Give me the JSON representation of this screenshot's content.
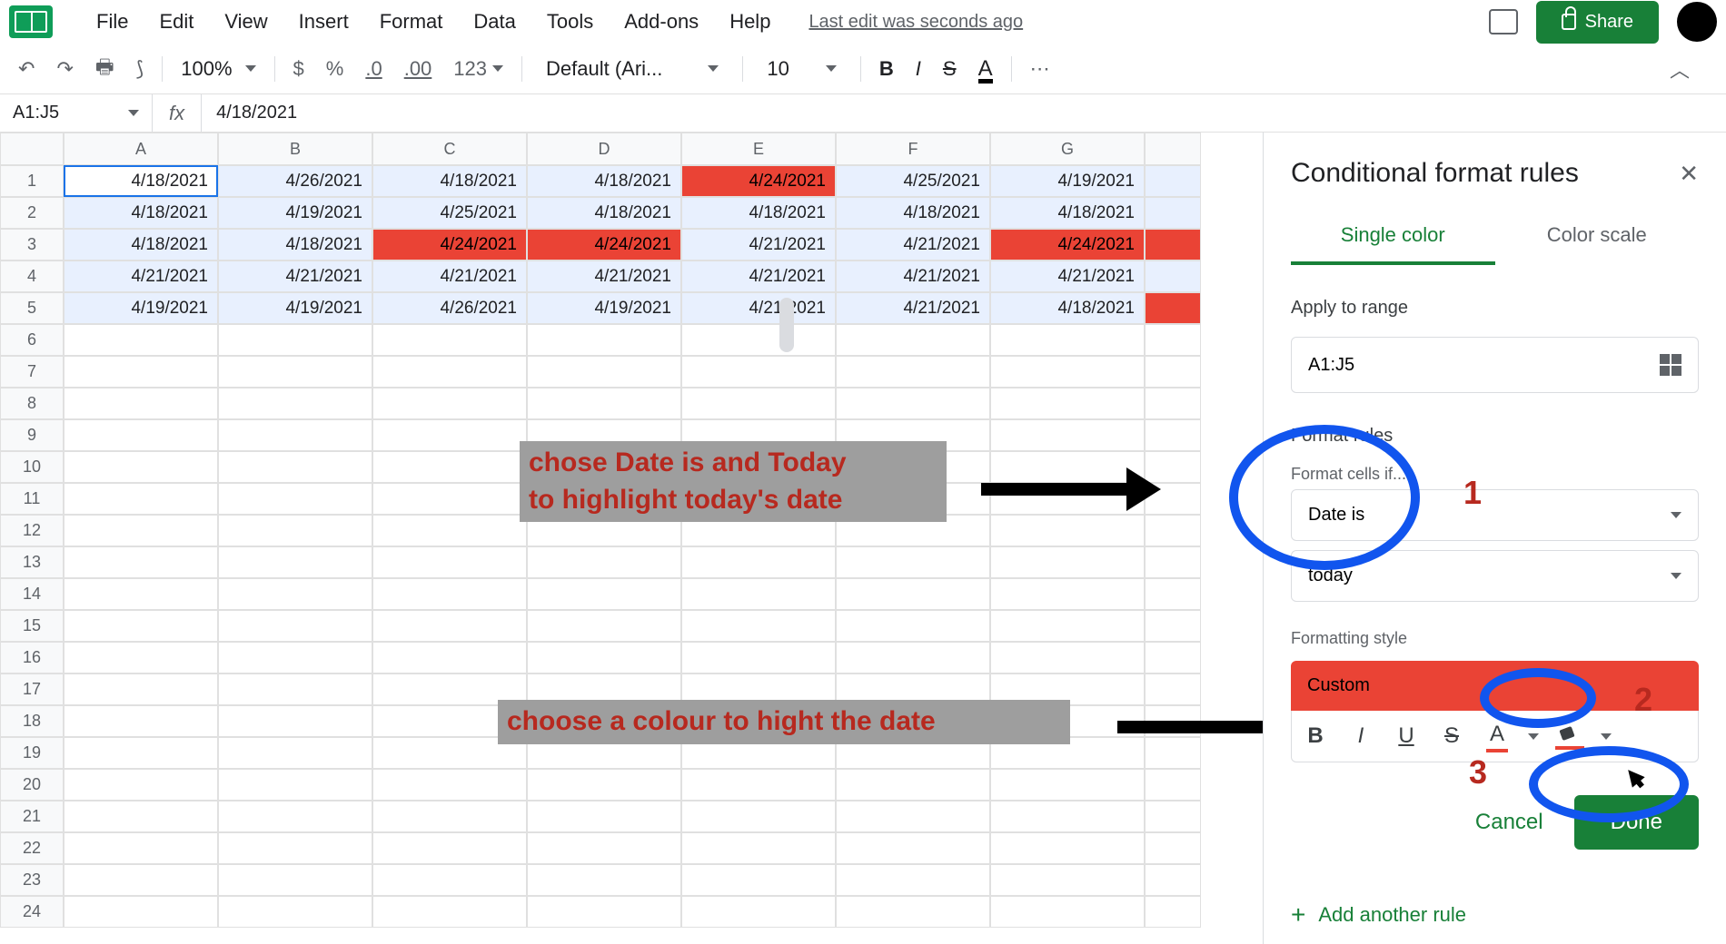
{
  "menu": {
    "items": [
      "File",
      "Edit",
      "View",
      "Insert",
      "Format",
      "Data",
      "Tools",
      "Add-ons",
      "Help"
    ],
    "last_edit": "Last edit was seconds ago",
    "share": "Share"
  },
  "toolbar": {
    "zoom": "100%",
    "font": "Default (Ari...",
    "font_size": "10",
    "number_fmt": "123",
    "currency": "$",
    "percent": "%",
    "dec_less": ".0",
    "dec_more": ".00",
    "bold": "B",
    "italic": "I",
    "strike": "S",
    "textcolor": "A",
    "more": "⋯"
  },
  "namebox": "A1:J5",
  "formula": "4/18/2021",
  "columns": [
    "A",
    "B",
    "C",
    "D",
    "E",
    "F",
    "G"
  ],
  "rows": [
    1,
    2,
    3,
    4,
    5,
    6,
    7,
    8,
    9,
    10,
    11,
    12,
    13,
    14,
    15,
    16,
    17,
    18,
    19,
    20,
    21,
    22,
    23,
    24
  ],
  "cells": [
    [
      "4/18/2021",
      "4/26/2021",
      "4/18/2021",
      "4/18/2021",
      "4/24/2021",
      "4/25/2021",
      "4/19/2021"
    ],
    [
      "4/18/2021",
      "4/19/2021",
      "4/25/2021",
      "4/18/2021",
      "4/18/2021",
      "4/18/2021",
      "4/18/2021"
    ],
    [
      "4/18/2021",
      "4/18/2021",
      "4/24/2021",
      "4/24/2021",
      "4/21/2021",
      "4/21/2021",
      "4/24/2021"
    ],
    [
      "4/21/2021",
      "4/21/2021",
      "4/21/2021",
      "4/21/2021",
      "4/21/2021",
      "4/21/2021",
      "4/21/2021"
    ],
    [
      "4/19/2021",
      "4/19/2021",
      "4/26/2021",
      "4/19/2021",
      "4/21/2021",
      "4/21/2021",
      "4/18/2021"
    ]
  ],
  "red_cells": [
    [
      0,
      4
    ],
    [
      2,
      2
    ],
    [
      2,
      3
    ],
    [
      2,
      6
    ]
  ],
  "sidepanel": {
    "title": "Conditional format rules",
    "tab_single": "Single color",
    "tab_scale": "Color scale",
    "apply_label": "Apply to range",
    "range": "A1:J5",
    "rules_label": "Format rules",
    "cells_if": "Format cells if...",
    "condition": "Date is",
    "condition2": "today",
    "style_label": "Formatting style",
    "style_preview": "Custom",
    "cancel": "Cancel",
    "done": "Done",
    "add_rule": "Add another rule"
  },
  "annotations": {
    "box1_l1": "chose Date is and Today",
    "box1_l2": "to highlight today's date",
    "box2": "choose a colour to hight the date",
    "num1": "1",
    "num2": "2",
    "num3": "3"
  }
}
